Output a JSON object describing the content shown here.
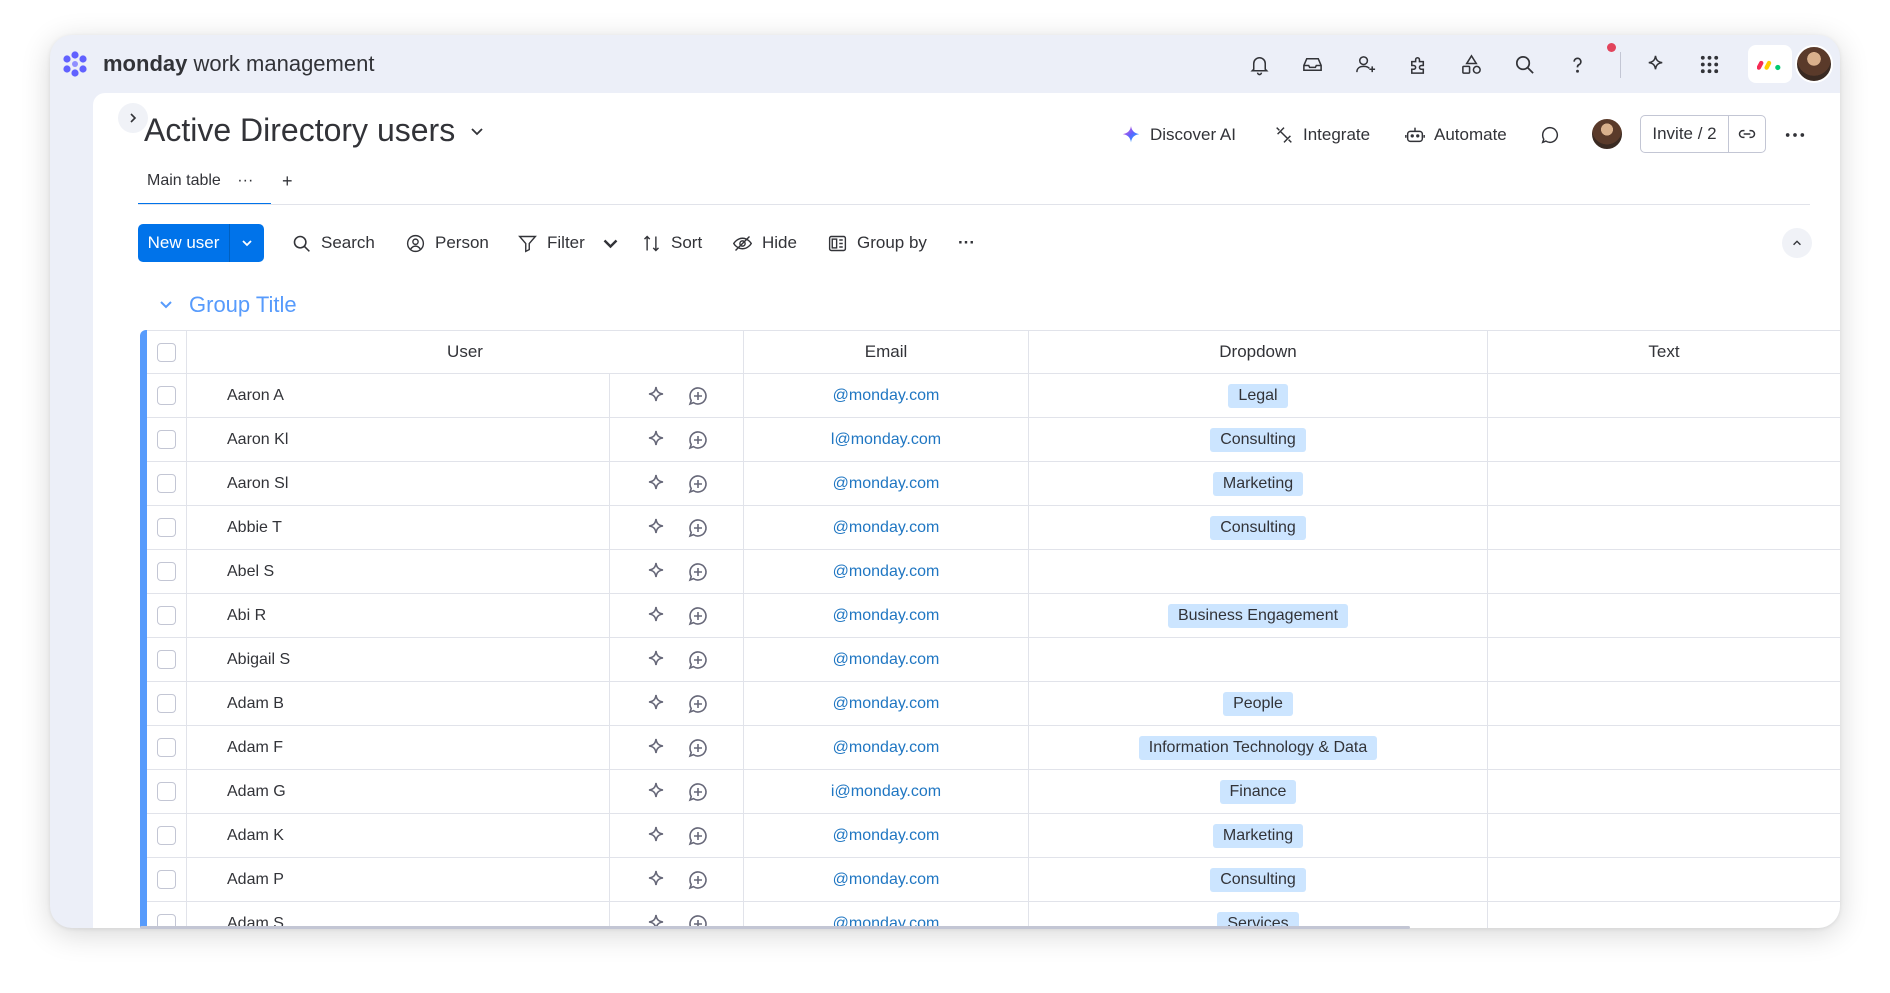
{
  "app": {
    "brand_bold": "monday",
    "brand_rest": " work management"
  },
  "board": {
    "title": "Active Directory users"
  },
  "header_actions": {
    "discover_ai": "Discover AI",
    "integrate": "Integrate",
    "automate": "Automate",
    "invite": "Invite / 2"
  },
  "tabs": [
    {
      "label": "Main table",
      "more": "···"
    }
  ],
  "tabs_add": "+",
  "toolbar": {
    "new_item": "New user",
    "search": "Search",
    "person": "Person",
    "filter": "Filter",
    "sort": "Sort",
    "hide": "Hide",
    "group_by": "Group by",
    "more": "···"
  },
  "group": {
    "title": "Group Title",
    "color": "#579bfc"
  },
  "columns": {
    "user": "User",
    "email": "Email",
    "dropdown": "Dropdown",
    "text": "Text"
  },
  "rows": [
    {
      "user": "Aaron A",
      "email": "@monday.com",
      "dropdown": "Legal",
      "text": ""
    },
    {
      "user": "Aaron Kl",
      "email": "l@monday.com",
      "dropdown": "Consulting",
      "text": ""
    },
    {
      "user": "Aaron Sl",
      "email": "@monday.com",
      "dropdown": "Marketing",
      "text": ""
    },
    {
      "user": "Abbie T",
      "email": "@monday.com",
      "dropdown": "Consulting",
      "text": ""
    },
    {
      "user": "Abel S",
      "email": "@monday.com",
      "dropdown": "",
      "text": ""
    },
    {
      "user": "Abi R",
      "email": "@monday.com",
      "dropdown": "Business Engagement",
      "text": ""
    },
    {
      "user": "Abigail S",
      "email": "@monday.com",
      "dropdown": "",
      "text": ""
    },
    {
      "user": "Adam B",
      "email": "@monday.com",
      "dropdown": "People",
      "text": ""
    },
    {
      "user": "Adam F",
      "email": "@monday.com",
      "dropdown": "Information Technology & Data",
      "text": ""
    },
    {
      "user": "Adam G",
      "email": "i@monday.com",
      "dropdown": "Finance",
      "text": ""
    },
    {
      "user": "Adam K",
      "email": "@monday.com",
      "dropdown": "Marketing",
      "text": ""
    },
    {
      "user": "Adam P",
      "email": "@monday.com",
      "dropdown": "Consulting",
      "text": ""
    },
    {
      "user": "Adam S",
      "email": "@monday.com",
      "dropdown": "Services",
      "text": ""
    }
  ],
  "colors": {
    "primary": "#0073ea",
    "chip": "#cce5ff",
    "link": "#1f76c2",
    "notification": "#e2445c"
  }
}
